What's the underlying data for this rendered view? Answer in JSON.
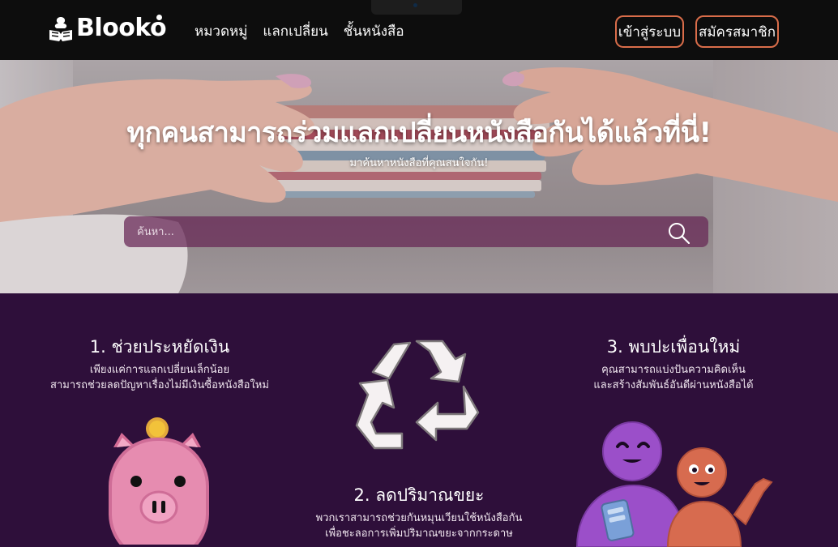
{
  "header": {
    "brand": "Blooko",
    "nav": [
      "หมวดหมู่",
      "แลกเปลี่ยน",
      "ชั้นหนังสือ"
    ],
    "login_label": "เข้าสู่ระบบ",
    "register_label": "สมัครสมาชิก"
  },
  "hero": {
    "title": "ทุกคนสามารถร่วมแลกเปลี่ยนหนังสือกันได้แล้วที่นี่!",
    "subtitle": "มาค้นหาหนังสือที่คุณสนใจกัน!",
    "search_placeholder": "ค้นหา..."
  },
  "features": [
    {
      "title": "1. ช่วยประหยัดเงิน",
      "desc_line1": "เพียงแค่การแลกเปลี่ยนเล็กน้อย",
      "desc_line2": "สามารถช่วยลดปัญหาเรื่องไม่มีเงินซื้อหนังสือใหม่"
    },
    {
      "title": "2. ลดปริมาณขยะ",
      "desc_line1": "พวกเราสามารถช่วยกันหมุนเวียนใช้หนังสือกัน",
      "desc_line2": "เพื่อชะลอการเพิ่มปริมาณขยะจากกระดาษ"
    },
    {
      "title": "3. พบปะเพื่อนใหม่",
      "desc_line1": "คุณสามารถแบ่งปันความคิดเห็น",
      "desc_line2": "และสร้างสัมพันธ์อันดีผ่านหนังสือได้"
    }
  ],
  "colors": {
    "header_bg": "#0d0d0d",
    "accent_border": "#d96d4a",
    "section_bg": "#2e0f3a",
    "search_bg": "#662654",
    "pig": "#e68cb0",
    "coin": "#f2c23a",
    "friend_purple": "#9b4fc9",
    "friend_orange": "#d76b4f"
  },
  "icons": [
    "book-flower-logo-icon",
    "search-icon",
    "recycle-icon",
    "piggy-bank-icon",
    "friends-icon"
  ]
}
